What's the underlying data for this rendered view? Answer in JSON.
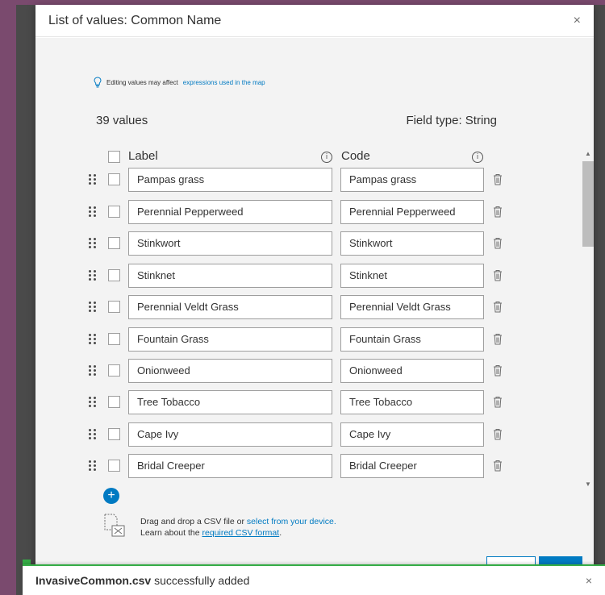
{
  "modal": {
    "title": "List of values: Common Name",
    "close": "×",
    "info_text": "Editing values may affect",
    "info_link": "expressions used in the map",
    "count": "39 values",
    "field_type": "Field type: String",
    "headers": {
      "label": "Label",
      "code": "Code"
    },
    "rows": [
      {
        "label": "Pampas grass",
        "code": "Pampas grass"
      },
      {
        "label": "Perennial Pepperweed",
        "code": "Perennial Pepperweed"
      },
      {
        "label": "Stinkwort",
        "code": "Stinkwort"
      },
      {
        "label": "Stinknet",
        "code": "Stinknet"
      },
      {
        "label": "Perennial Veldt Grass",
        "code": "Perennial Veldt Grass"
      },
      {
        "label": "Fountain Grass",
        "code": "Fountain Grass"
      },
      {
        "label": "Onionweed",
        "code": "Onionweed"
      },
      {
        "label": "Tree Tobacco",
        "code": "Tree Tobacco"
      },
      {
        "label": "Cape Ivy",
        "code": "Cape Ivy"
      },
      {
        "label": "Bridal Creeper",
        "code": "Bridal Creeper"
      }
    ],
    "add_symbol": "+",
    "csv": {
      "line1_prefix": "Drag and drop a CSV file or",
      "line1_link": "select from your device.",
      "line2_prefix": "Learn about the",
      "line2_link": "required CSV format",
      "line2_suffix": "."
    }
  },
  "toast": {
    "filename": "InvasiveCommon.csv",
    "message": "successfully added",
    "close": "×"
  },
  "colors": {
    "accent": "#007ac2",
    "success": "#35ac46",
    "backdrop": "#7a4a6e"
  }
}
